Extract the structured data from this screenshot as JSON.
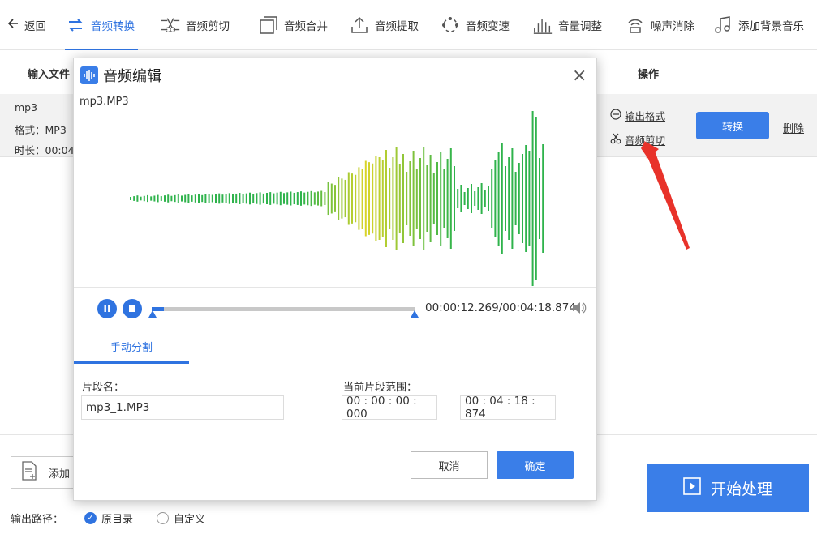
{
  "toolbar": {
    "back": "返回",
    "items": [
      {
        "label": "音频转换",
        "icon": "convert-icon"
      },
      {
        "label": "音频剪切",
        "icon": "scissors-icon"
      },
      {
        "label": "音频合并",
        "icon": "merge-icon"
      },
      {
        "label": "音频提取",
        "icon": "extract-icon"
      },
      {
        "label": "音频变速",
        "icon": "speed-icon"
      },
      {
        "label": "音量调整",
        "icon": "volume-bars-icon"
      },
      {
        "label": "噪声消除",
        "icon": "noise-icon"
      },
      {
        "label": "添加背景音乐",
        "icon": "music-note-icon"
      }
    ],
    "active_index": 0
  },
  "table": {
    "col_input": "输入文件",
    "col_ops": "操作",
    "file": {
      "name": "mp3",
      "format": "格式：MP3",
      "duration": "时长：00:04"
    },
    "output_format_link": "输出格式",
    "audio_cut_link": "音频剪切",
    "convert_button": "转换",
    "delete_link": "删除"
  },
  "bottom": {
    "add_button": "添加",
    "output_path_label": "输出路径：",
    "radio_original": "原目录",
    "radio_custom": "自定义",
    "start_button": "开始处理"
  },
  "dialog": {
    "title": "音频编辑",
    "file_label": "mp3.MP3",
    "time": "00:00:12.269/00:04:18.874",
    "progress": 0.046,
    "tab": "手动分割",
    "segment_name_label": "片段名：",
    "segment_name_value": "mp3_1.MP3",
    "range_label": "当前片段范围：",
    "range_start": "00 : 00 : 00 : 000",
    "range_end": "00 : 04 : 18 : 874",
    "cancel_button": "取消",
    "ok_button": "确定"
  },
  "colors": {
    "accent": "#2f73e0",
    "button": "#3a7ee8",
    "annotation": "#e8322a",
    "wave_green": "#2fb34c",
    "wave_yellow": "#d8d42a"
  }
}
